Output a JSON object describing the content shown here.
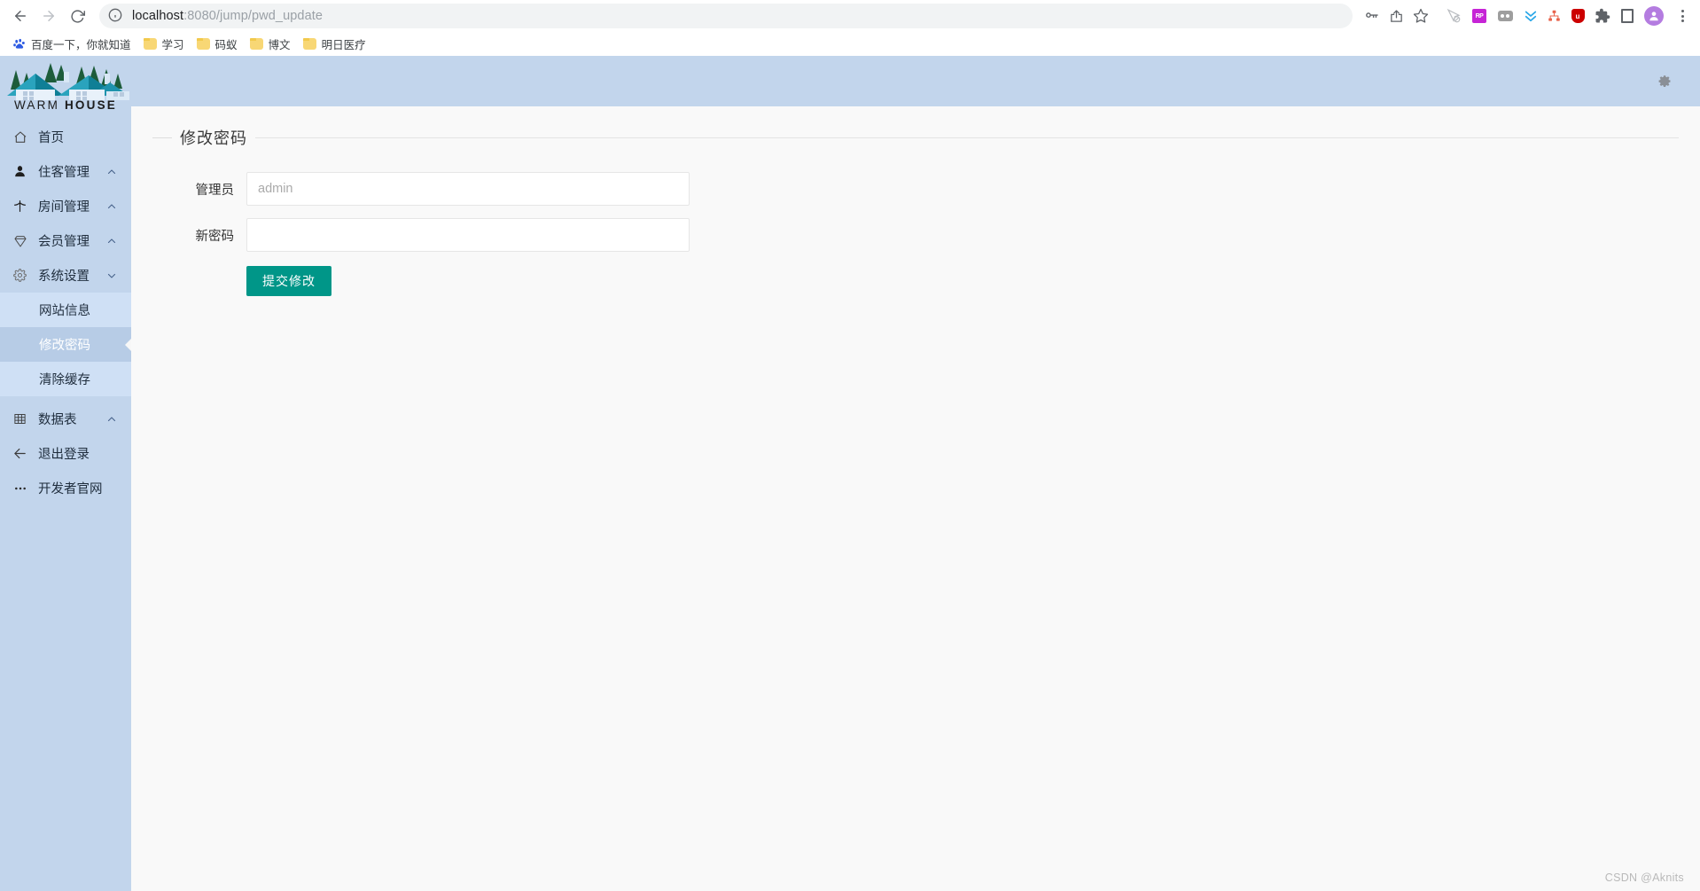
{
  "browser": {
    "back_icon": "back-arrow-icon",
    "forward_icon": "forward-arrow-icon",
    "reload_icon": "reload-icon",
    "url_host": "localhost",
    "url_path": ":8080/jump/pwd_update",
    "url_full": "localhost:8080/jump/pwd_update",
    "omni_icons": [
      "password-key-icon",
      "share-icon",
      "bookmark-star-icon"
    ],
    "extensions": [
      "cursor-block-icon",
      "rp-icon",
      "dualdrive-icon",
      "download-chevrons-icon",
      "sitemap-icon",
      "ublock-shield-icon",
      "puzzle-extensions-icon",
      "sidepanel-icon"
    ],
    "extension_rp_label": "RP",
    "extension_ublock_label": "u",
    "profile_icon": "profile-avatar-icon",
    "menu_icon": "three-dot-menu-icon",
    "bookmarks": [
      {
        "label": "百度一下，你就知道",
        "icon": "baidu-icon"
      },
      {
        "label": "学习",
        "icon": "folder-icon"
      },
      {
        "label": "码蚁",
        "icon": "folder-icon"
      },
      {
        "label": "博文",
        "icon": "folder-icon"
      },
      {
        "label": "明日医疗",
        "icon": "folder-icon"
      }
    ]
  },
  "app": {
    "logo_text_light": "WARM ",
    "logo_text_bold": "HOUSE",
    "logo_alt": "warm-house-logo",
    "topbar": {
      "settings_icon": "gear-icon"
    },
    "colors": {
      "sidebar_bg": "#c2d5ec",
      "submenu_bg": "#cfe0f5",
      "active_bg": "#b7cce6",
      "content_bg": "#f9f9f9",
      "accent": "#009688"
    }
  },
  "sidebar": {
    "items": [
      {
        "label": "首页",
        "icon": "home-icon",
        "arrow": ""
      },
      {
        "label": "住客管理",
        "icon": "user-icon",
        "arrow": "up"
      },
      {
        "label": "房间管理",
        "icon": "bed-icon",
        "arrow": "up"
      },
      {
        "label": "会员管理",
        "icon": "diamond-icon",
        "arrow": "up"
      },
      {
        "label": "系统设置",
        "icon": "gear-icon",
        "arrow": "down"
      }
    ],
    "submenu": [
      {
        "label": "网站信息",
        "active": false
      },
      {
        "label": "修改密码",
        "active": true
      },
      {
        "label": "清除缓存",
        "active": false
      }
    ],
    "items_bottom": [
      {
        "label": "数据表",
        "icon": "table-icon",
        "arrow": "up"
      },
      {
        "label": "退出登录",
        "icon": "logout-icon",
        "arrow": ""
      },
      {
        "label": "开发者官网",
        "icon": "ellipsis-icon",
        "arrow": ""
      }
    ]
  },
  "form": {
    "legend": "修改密码",
    "admin_label": "管理员",
    "admin_placeholder": "admin",
    "admin_value": "",
    "password_label": "新密码",
    "password_placeholder": "",
    "password_value": "",
    "submit_label": "提交修改"
  },
  "footer": {
    "watermark": "CSDN @Aknits"
  }
}
